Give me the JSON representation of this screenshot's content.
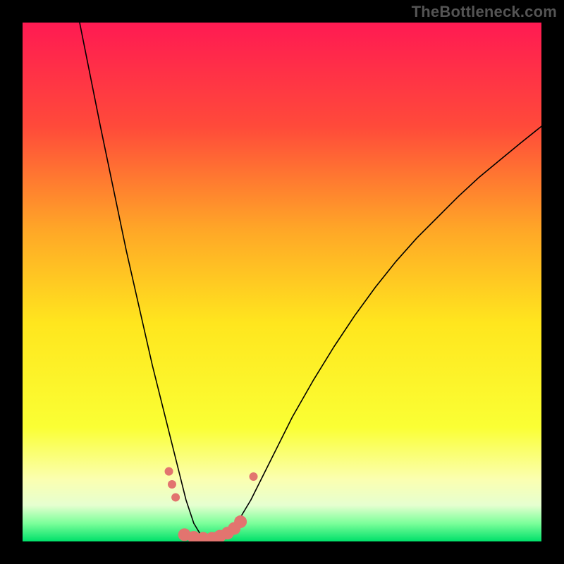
{
  "watermark": "TheBottleneck.com",
  "chart_data": {
    "type": "line",
    "title": "",
    "xlabel": "",
    "ylabel": "",
    "xlim": [
      0,
      100
    ],
    "ylim": [
      0,
      100
    ],
    "grid": false,
    "legend": false,
    "background_gradient": {
      "stops": [
        {
          "offset": 0.0,
          "color": "#ff1a52"
        },
        {
          "offset": 0.2,
          "color": "#ff4a3a"
        },
        {
          "offset": 0.4,
          "color": "#ffa727"
        },
        {
          "offset": 0.58,
          "color": "#ffe61e"
        },
        {
          "offset": 0.78,
          "color": "#faff34"
        },
        {
          "offset": 0.88,
          "color": "#fbffb0"
        },
        {
          "offset": 0.93,
          "color": "#e6ffd0"
        },
        {
          "offset": 0.965,
          "color": "#7cff9a"
        },
        {
          "offset": 1.0,
          "color": "#00e06a"
        }
      ]
    },
    "series": [
      {
        "name": "curve",
        "color": "#000000",
        "width": 1.6,
        "x": [
          11.0,
          13.0,
          15.0,
          17.5,
          20.0,
          22.5,
          25.0,
          27.0,
          28.5,
          30.0,
          31.5,
          33.0,
          34.5,
          36.0,
          37.5,
          39.0,
          41.0,
          44.0,
          48.0,
          52.0,
          56.0,
          60.0,
          64.0,
          68.0,
          72.0,
          76.0,
          80.0,
          84.0,
          88.0,
          92.0,
          96.0,
          100.0
        ],
        "y": [
          100.0,
          90.0,
          80.0,
          68.0,
          56.0,
          45.0,
          34.0,
          26.0,
          20.0,
          14.0,
          8.0,
          3.5,
          1.0,
          0.0,
          0.0,
          1.0,
          3.0,
          8.0,
          16.0,
          24.0,
          31.0,
          37.5,
          43.5,
          49.0,
          54.0,
          58.5,
          62.5,
          66.5,
          70.2,
          73.5,
          76.8,
          80.0
        ]
      }
    ],
    "markers": {
      "name": "points",
      "color": "#e2746f",
      "radius_small": 6.0,
      "radius_large": 9.0,
      "items": [
        {
          "x": 28.2,
          "y": 13.5,
          "r": "small"
        },
        {
          "x": 28.8,
          "y": 11.0,
          "r": "small"
        },
        {
          "x": 29.5,
          "y": 8.5,
          "r": "small"
        },
        {
          "x": 31.2,
          "y": 1.3,
          "r": "large"
        },
        {
          "x": 33.0,
          "y": 0.8,
          "r": "large"
        },
        {
          "x": 34.8,
          "y": 0.6,
          "r": "large"
        },
        {
          "x": 36.5,
          "y": 0.6,
          "r": "large"
        },
        {
          "x": 38.0,
          "y": 1.0,
          "r": "large"
        },
        {
          "x": 39.5,
          "y": 1.6,
          "r": "large"
        },
        {
          "x": 40.8,
          "y": 2.5,
          "r": "large"
        },
        {
          "x": 42.0,
          "y": 3.8,
          "r": "large"
        },
        {
          "x": 44.5,
          "y": 12.5,
          "r": "small"
        }
      ]
    }
  }
}
